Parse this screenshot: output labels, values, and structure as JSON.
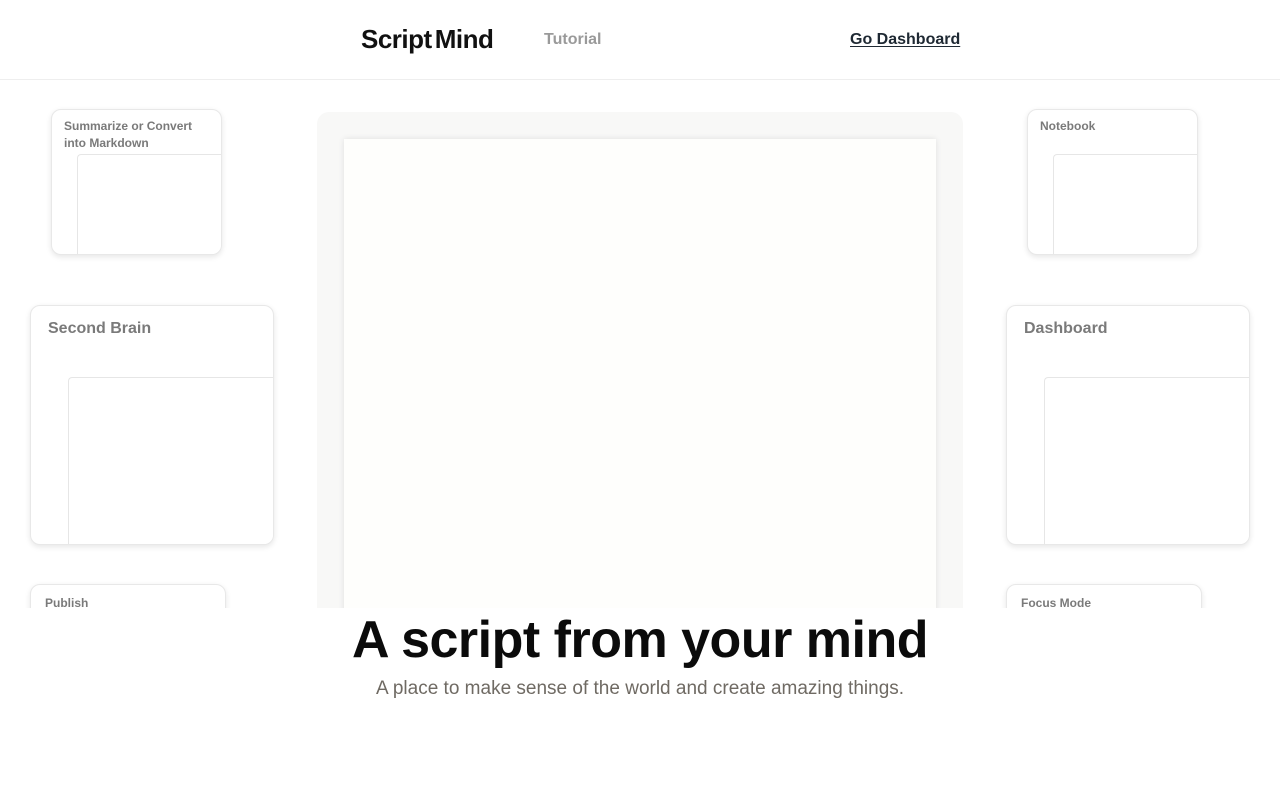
{
  "header": {
    "logo_first": "Script",
    "logo_second": "Mind",
    "nav_tutorial": "Tutorial",
    "nav_dashboard": "Go Dashboard"
  },
  "cards": {
    "summarize": "Summarize or Convert into Markdown",
    "notebook": "Notebook",
    "second_brain": "Second Brain",
    "dashboard": "Dashboard",
    "publish": "Publish",
    "focus_mode": "Focus Mode"
  },
  "hero": {
    "title": "A script from your mind",
    "subtitle": "A place to make sense of the world and create amazing things."
  }
}
